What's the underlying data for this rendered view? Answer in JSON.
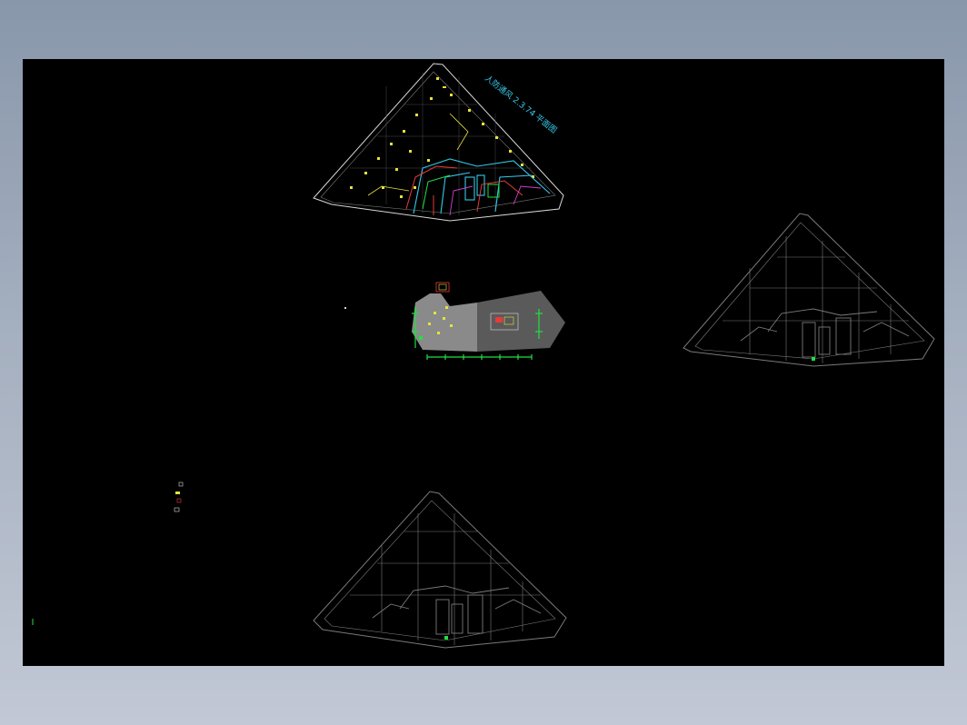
{
  "viewer": {
    "background_top": "#8997ab",
    "background_bottom": "#c2c8d5",
    "canvas_color": "#000000"
  },
  "drawing": {
    "title": "人防通风 2.3.74 平面图"
  },
  "colors": {
    "cyan": "#35c8e8",
    "yellow": "#e8e23a",
    "red": "#e83a3a",
    "green": "#20e040",
    "magenta": "#d040d0",
    "white": "#d8d8d8",
    "gray": "#7a7a7a",
    "panel_gray": "#5a5a5a"
  }
}
